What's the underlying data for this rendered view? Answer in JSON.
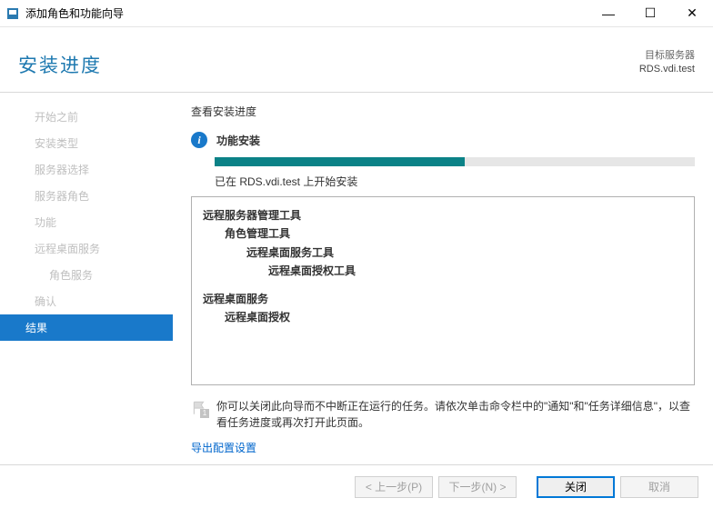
{
  "window": {
    "title": "添加角色和功能向导",
    "minimize": "—",
    "maximize": "☐",
    "close": "✕"
  },
  "header": {
    "page_title": "安装进度",
    "target_label": "目标服务器",
    "target_value": "RDS.vdi.test"
  },
  "sidebar": {
    "steps": [
      {
        "label": "开始之前"
      },
      {
        "label": "安装类型"
      },
      {
        "label": "服务器选择"
      },
      {
        "label": "服务器角色"
      },
      {
        "label": "功能"
      },
      {
        "label": "远程桌面服务"
      },
      {
        "label": "角色服务",
        "sub": true
      },
      {
        "label": "确认"
      },
      {
        "label": "结果",
        "active": true
      }
    ]
  },
  "content": {
    "view_label": "查看安装进度",
    "status": "功能安装",
    "progress_pct": 52,
    "progress_msg": "已在 RDS.vdi.test 上开始安装",
    "features": [
      {
        "level": 0,
        "text": "远程服务器管理工具"
      },
      {
        "level": 1,
        "text": "角色管理工具"
      },
      {
        "level": 2,
        "text": "远程桌面服务工具"
      },
      {
        "level": 3,
        "text": "远程桌面授权工具"
      },
      {
        "level": 0,
        "text": "远程桌面服务"
      },
      {
        "level": 1,
        "text": "远程桌面授权"
      }
    ],
    "note": "你可以关闭此向导而不中断正在运行的任务。请依次单击命令栏中的\"通知\"和\"任务详细信息\"，以查看任务进度或再次打开此页面。",
    "export_link": "导出配置设置"
  },
  "footer": {
    "prev": "< 上一步(P)",
    "next": "下一步(N) >",
    "close": "关闭",
    "cancel": "取消"
  }
}
